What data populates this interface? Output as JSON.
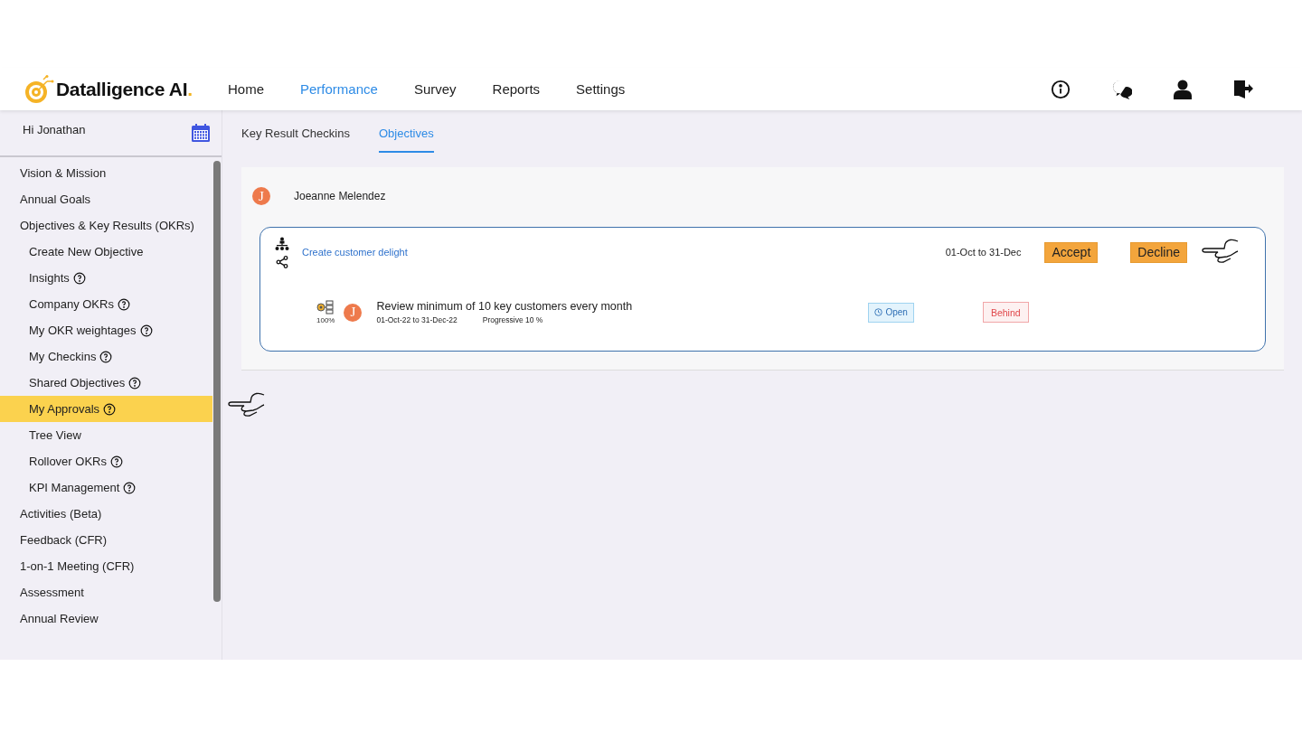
{
  "logo": {
    "name": "Datalligence AI",
    "dot": "."
  },
  "nav": [
    {
      "label": "Home",
      "selected": false
    },
    {
      "label": "Performance",
      "selected": true
    },
    {
      "label": "Survey",
      "selected": false
    },
    {
      "label": "Reports",
      "selected": false
    },
    {
      "label": "Settings",
      "selected": false
    }
  ],
  "sidebar": {
    "greeting": "Hi Jonathan",
    "items": [
      {
        "label": "Vision & Mission",
        "selected": false,
        "help": false
      },
      {
        "label": "Annual Goals",
        "selected": false,
        "help": false
      },
      {
        "label": "Objectives & Key Results (OKRs)",
        "selected": false,
        "help": false,
        "children": [
          {
            "label": "Create New Objective",
            "selected": false,
            "help": false
          },
          {
            "label": "Insights",
            "selected": false,
            "help": true
          },
          {
            "label": "Company OKRs",
            "selected": false,
            "help": true
          },
          {
            "label": "My OKR weightages",
            "selected": false,
            "help": true
          },
          {
            "label": "My Checkins",
            "selected": false,
            "help": true
          },
          {
            "label": "Shared Objectives",
            "selected": false,
            "help": true
          },
          {
            "label": "My Approvals",
            "selected": true,
            "help": true
          },
          {
            "label": "Tree View",
            "selected": false,
            "help": false
          },
          {
            "label": "Rollover OKRs",
            "selected": false,
            "help": true
          },
          {
            "label": "KPI Management",
            "selected": false,
            "help": true
          }
        ]
      },
      {
        "label": "Activities (Beta)",
        "selected": false,
        "help": false
      },
      {
        "label": "Feedback (CFR)",
        "selected": false,
        "help": false
      },
      {
        "label": "1-on-1 Meeting (CFR)",
        "selected": false,
        "help": false
      },
      {
        "label": "Assessment",
        "selected": false,
        "help": false
      },
      {
        "label": "Annual Review",
        "selected": false,
        "help": false
      }
    ]
  },
  "tabs": [
    {
      "label": "Key Result Checkins",
      "selected": false
    },
    {
      "label": "Objectives",
      "selected": true
    }
  ],
  "approval": {
    "initial": "J",
    "name": "Joeanne Melendez",
    "objective": {
      "title": "Create customer delight",
      "period": "01-Oct to 31-Dec",
      "buttons": [
        "Accept",
        "Decline"
      ]
    },
    "key_result": {
      "progress": "100%",
      "initial": "J",
      "title": "Review minimum of 10 key customers every month",
      "dates": "01-Oct-22 to 31-Dec-22",
      "type": "Progressive 10 %",
      "status": "Open",
      "track": "Behind"
    }
  }
}
